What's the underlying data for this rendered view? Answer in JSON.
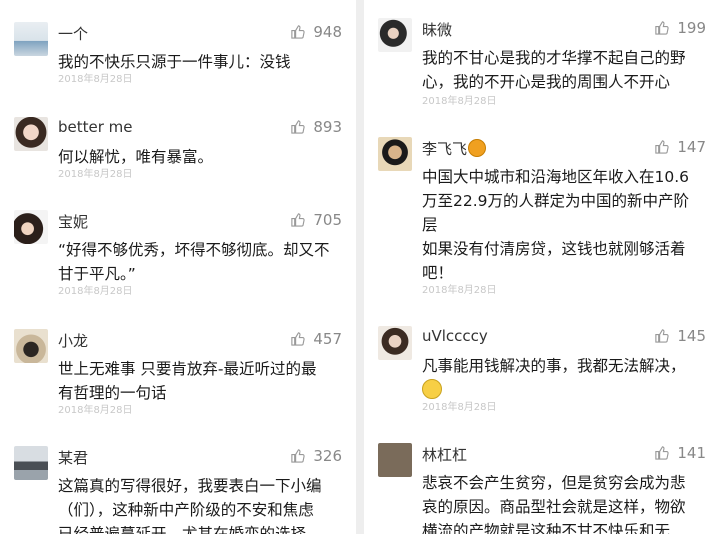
{
  "left": {
    "comments": [
      {
        "user": "一个",
        "likes": "948",
        "lines": [
          "我的不快乐只源于一件事儿：没钱"
        ],
        "date": "2018年8月28日"
      },
      {
        "user": "better me",
        "likes": "893",
        "lines": [
          "何以解忧，唯有暴富。"
        ],
        "date": "2018年8月28日"
      },
      {
        "user": "宝妮",
        "likes": "705",
        "lines": [
          "“好得不够优秀，坏得不够彻底。却又不",
          "甘于平凡。”"
        ],
        "date": "2018年8月28日"
      },
      {
        "user": "小龙",
        "likes": "457",
        "lines": [
          "世上无难事 只要肯放弃-最近听过的最",
          "有哲理的一句话"
        ],
        "date": "2018年8月28日"
      },
      {
        "user": "某君",
        "likes": "326",
        "lines": [
          "这篇真的写得很好，我要表白一下小编",
          "（们），这种新中产阶级的不安和焦虑",
          "已经普遍蔓延开，尤其在婚恋的选择"
        ],
        "date": ""
      }
    ]
  },
  "right": {
    "comments": [
      {
        "user": "昧微",
        "likes": "199",
        "lines": [
          "我的不甘心是我的才华撑不起自己的野",
          "心，我的不开心是我的周围人不开心"
        ],
        "date": "2018年8月28日"
      },
      {
        "user": "李飞飞",
        "likes": "147",
        "lines": [
          "中国大中城市和沿海地区年收入在10.6",
          "万至22.9万的人群定为中国的新中产阶",
          "层",
          "如果没有付清房贷，这钱也就刚够活着",
          "吧！"
        ],
        "date": "2018年8月28日"
      },
      {
        "user": "uVlccccy",
        "likes": "145",
        "lines": [
          "凡事能用钱解决的事，我都无法解决，"
        ],
        "date": "2018年8月28日"
      },
      {
        "user": "林杠杠",
        "likes": "141",
        "lines": [
          "悲哀不会产生贫穷，但是贫穷会成为悲",
          "哀的原因。商品型社会就是这样，物欲",
          "横流的产物就是这种不甘不快乐和无"
        ],
        "date": ""
      }
    ]
  },
  "colors": {
    "likes": "#888888",
    "date": "#c8c8c8",
    "divider": "#eeeeee",
    "text": "#1a1a1a"
  },
  "icons": [
    "thumbs-up-icon",
    "emoji-smile-icon",
    "emoji-gold-icon"
  ]
}
